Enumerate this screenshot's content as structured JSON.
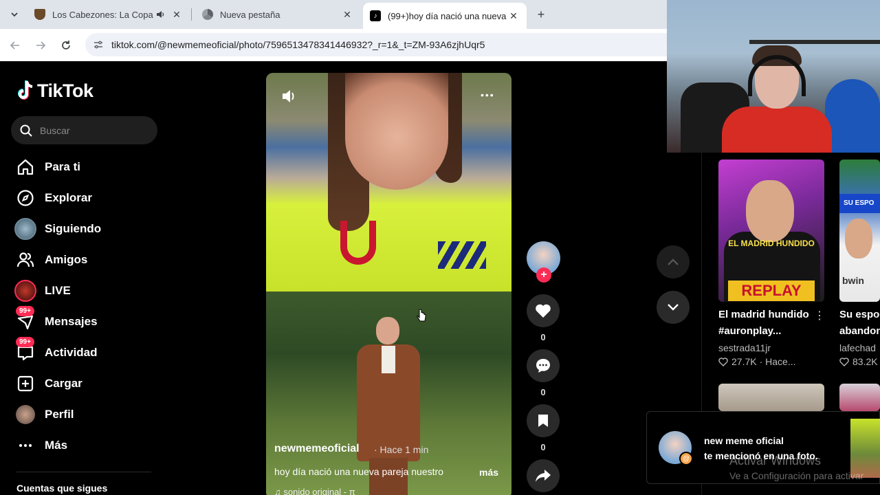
{
  "browser": {
    "tabs": [
      {
        "title": "Los Cabezones: La Copa Mu",
        "icon": "game-shield-icon"
      },
      {
        "title": "Nueva pestaña",
        "icon": "chrome-icon"
      },
      {
        "title": "(99+)hoy día nació una nueva p",
        "icon": "tiktok-icon"
      }
    ],
    "url": "tiktok.com/@newmemeoficial/photo/7596513478341446932?_r=1&_t=ZM-93A6zjhUqr5"
  },
  "sidebar": {
    "logo_text": "TikTok",
    "search_placeholder": "Buscar",
    "items": [
      {
        "label": "Para ti",
        "icon": "home-icon"
      },
      {
        "label": "Explorar",
        "icon": "compass-icon"
      },
      {
        "label": "Siguiendo",
        "icon": "following-avatar-icon"
      },
      {
        "label": "Amigos",
        "icon": "friends-icon"
      },
      {
        "label": "LIVE",
        "icon": "live-icon"
      },
      {
        "label": "Mensajes",
        "icon": "messages-icon",
        "badge": "99+"
      },
      {
        "label": "Actividad",
        "icon": "activity-icon",
        "badge": "99+"
      },
      {
        "label": "Cargar",
        "icon": "upload-icon"
      },
      {
        "label": "Perfil",
        "icon": "profile-avatar-icon"
      },
      {
        "label": "Más",
        "icon": "more-icon"
      }
    ],
    "following_heading": "Cuentas que sigues"
  },
  "post": {
    "username": "newmemeoficial",
    "time": "· Hace 1 min",
    "caption": "hoy día nació una nueva pareja nuestro",
    "more": "más",
    "sound": "♫ sonido original - π",
    "likes": "0",
    "comments": "0",
    "saves": "0"
  },
  "recommendations": [
    {
      "thumb_caption_1": "EL MADRID HUNDIDO",
      "thumb_caption_2": "REPLAY",
      "title_line1": "El madrid hundido",
      "title_line2": "#auronplay...",
      "author": "sestrada11jr",
      "likes": "27.7K",
      "time": "· Hace..."
    },
    {
      "thumb_caption_1": "SU ESPO",
      "thumb_caption_2": "bwin",
      "title_line1": "Su espo",
      "title_line2": "abandon",
      "author": "lafechad",
      "likes": "83.2K",
      "time": ""
    }
  ],
  "notification": {
    "name": "new meme oficial",
    "message": "te mencionó en una foto."
  },
  "watermark": {
    "line1": "Activar Windows",
    "line2": "Ve a Configuración para activar"
  },
  "colors": {
    "accent": "#fe2c55",
    "background": "#000000"
  }
}
